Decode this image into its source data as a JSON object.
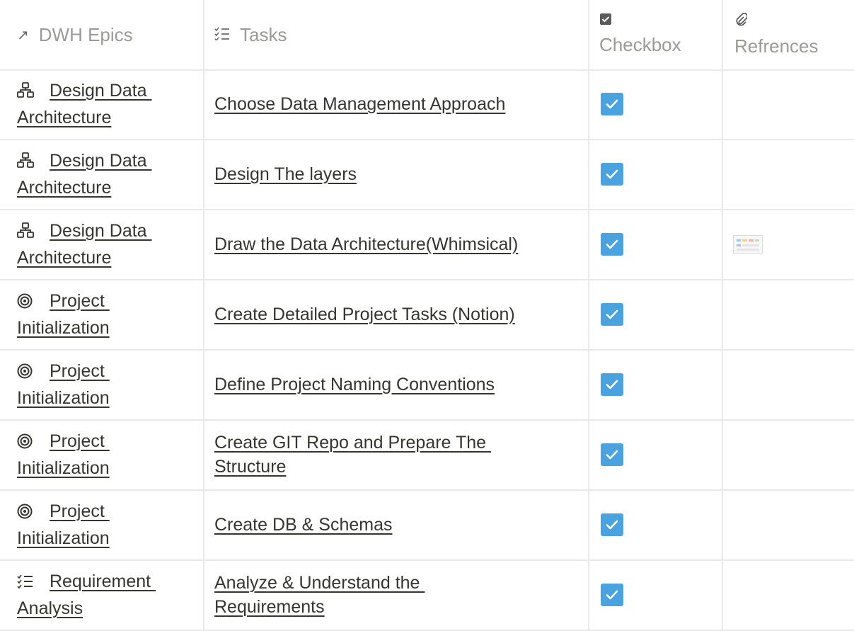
{
  "columns": [
    {
      "icon": "arrow-up-right-icon",
      "glyph": "↗",
      "label": "DWH Epics"
    },
    {
      "icon": "checklist-icon",
      "glyph": "☰",
      "label": "Tasks"
    },
    {
      "icon": "checkbox-icon",
      "glyph": "☑",
      "label": "Checkbox"
    },
    {
      "icon": "paperclip-icon",
      "glyph": "🔗",
      "label": "Refrences"
    }
  ],
  "rows": [
    {
      "epic_icon": "hierarchy-icon",
      "epic_l1": "Design Data ",
      "epic_l2": "Architecture",
      "task_l1": "Choose Data Management Approach",
      "task_l2": "",
      "checked": true,
      "has_ref": false
    },
    {
      "epic_icon": "hierarchy-icon",
      "epic_l1": "Design Data ",
      "epic_l2": "Architecture",
      "task_l1": "Design The layers",
      "task_l2": "",
      "checked": true,
      "has_ref": false
    },
    {
      "epic_icon": "hierarchy-icon",
      "epic_l1": "Design Data ",
      "epic_l2": "Architecture",
      "task_l1": "Draw the Data Architecture(Whimsical)",
      "task_l2": "",
      "checked": true,
      "has_ref": true
    },
    {
      "epic_icon": "target-icon",
      "epic_l1": "Project ",
      "epic_l2": "Initialization",
      "task_l1": "Create Detailed Project Tasks (Notion)",
      "task_l2": "",
      "checked": true,
      "has_ref": false
    },
    {
      "epic_icon": "target-icon",
      "epic_l1": "Project ",
      "epic_l2": "Initialization",
      "task_l1": "Define Project Naming Conventions",
      "task_l2": "",
      "checked": true,
      "has_ref": false
    },
    {
      "epic_icon": "target-icon",
      "epic_l1": "Project ",
      "epic_l2": "Initialization",
      "task_l1": "Create GIT Repo and Prepare The ",
      "task_l2": "Structure",
      "checked": true,
      "has_ref": false
    },
    {
      "epic_icon": "target-icon",
      "epic_l1": "Project ",
      "epic_l2": "Initialization",
      "task_l1": "Create DB & Schemas",
      "task_l2": "",
      "checked": true,
      "has_ref": false
    },
    {
      "epic_icon": "checklist-icon",
      "epic_l1": "Requirement ",
      "epic_l2": "Analysis",
      "task_l1": "Analyze & Understand the ",
      "task_l2": "Requirements",
      "checked": true,
      "has_ref": false
    }
  ],
  "colors": {
    "checkbox": "#4aa3df",
    "grid": "#e9e9e7",
    "header_text": "#9b9a97"
  }
}
